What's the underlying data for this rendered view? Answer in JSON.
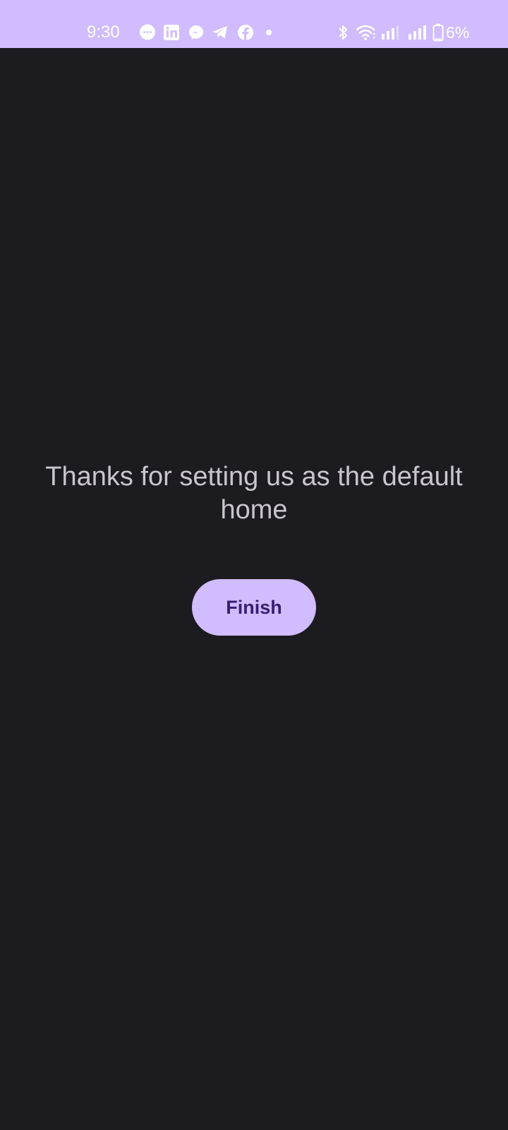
{
  "status_bar": {
    "time": "9:30",
    "battery_text": "6%",
    "notification_icons": [
      "messages-icon",
      "linkedin-icon",
      "messenger-icon",
      "telegram-icon",
      "facebook-icon",
      "dot-icon"
    ],
    "system_icons": [
      "bluetooth-icon",
      "wifi-icon",
      "signal-icon",
      "signal-icon",
      "battery-icon"
    ],
    "background_color": "#d0bcfe"
  },
  "main": {
    "message": "Thanks for setting us as the default home",
    "finish_label": "Finish",
    "background_color": "#1c1b20",
    "button_color": "#d0bcfe",
    "button_text_color": "#381e72"
  }
}
